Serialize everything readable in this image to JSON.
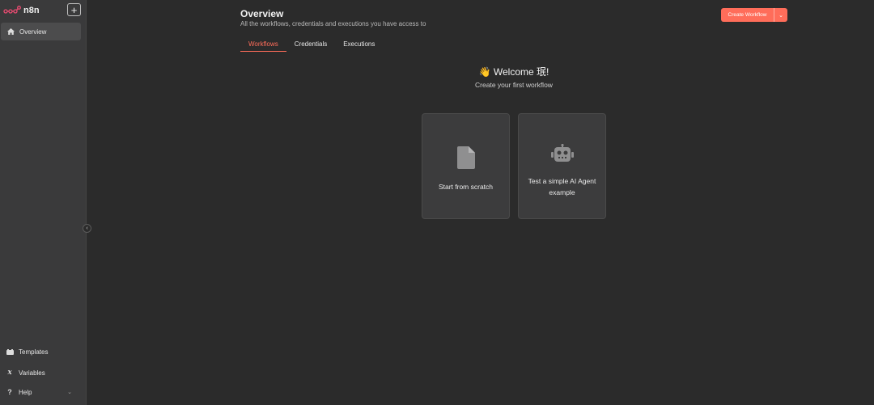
{
  "app": {
    "brand_name": "n8n"
  },
  "sidebar": {
    "add_label": "+",
    "items": [
      {
        "label": "Overview",
        "icon": "home-icon"
      }
    ],
    "bottom_items": [
      {
        "label": "Templates",
        "icon": "templates-icon"
      },
      {
        "label": "Variables",
        "icon": "variables-icon"
      },
      {
        "label": "Help",
        "icon": "help-icon"
      }
    ],
    "collapse_glyph": "‹",
    "help_chevron": "⌄"
  },
  "header": {
    "title": "Overview",
    "subtitle": "All the workflows, credentials and executions you have access to",
    "create_button_label": "Create Workflow",
    "create_dropdown_glyph": "⌄"
  },
  "tabs": [
    {
      "label": "Workflows",
      "active": true
    },
    {
      "label": "Credentials",
      "active": false
    },
    {
      "label": "Executions",
      "active": false
    }
  ],
  "welcome": {
    "title": "👋 Welcome 珉!",
    "subtitle": "Create your first workflow"
  },
  "cards": [
    {
      "label": "Start from scratch",
      "icon": "file-icon"
    },
    {
      "label": "Test a simple AI Agent example",
      "icon": "robot-icon"
    }
  ],
  "colors": {
    "accent": "#ff6d5a",
    "background": "#2b2b2b",
    "sidebar": "#3a3a3b"
  }
}
